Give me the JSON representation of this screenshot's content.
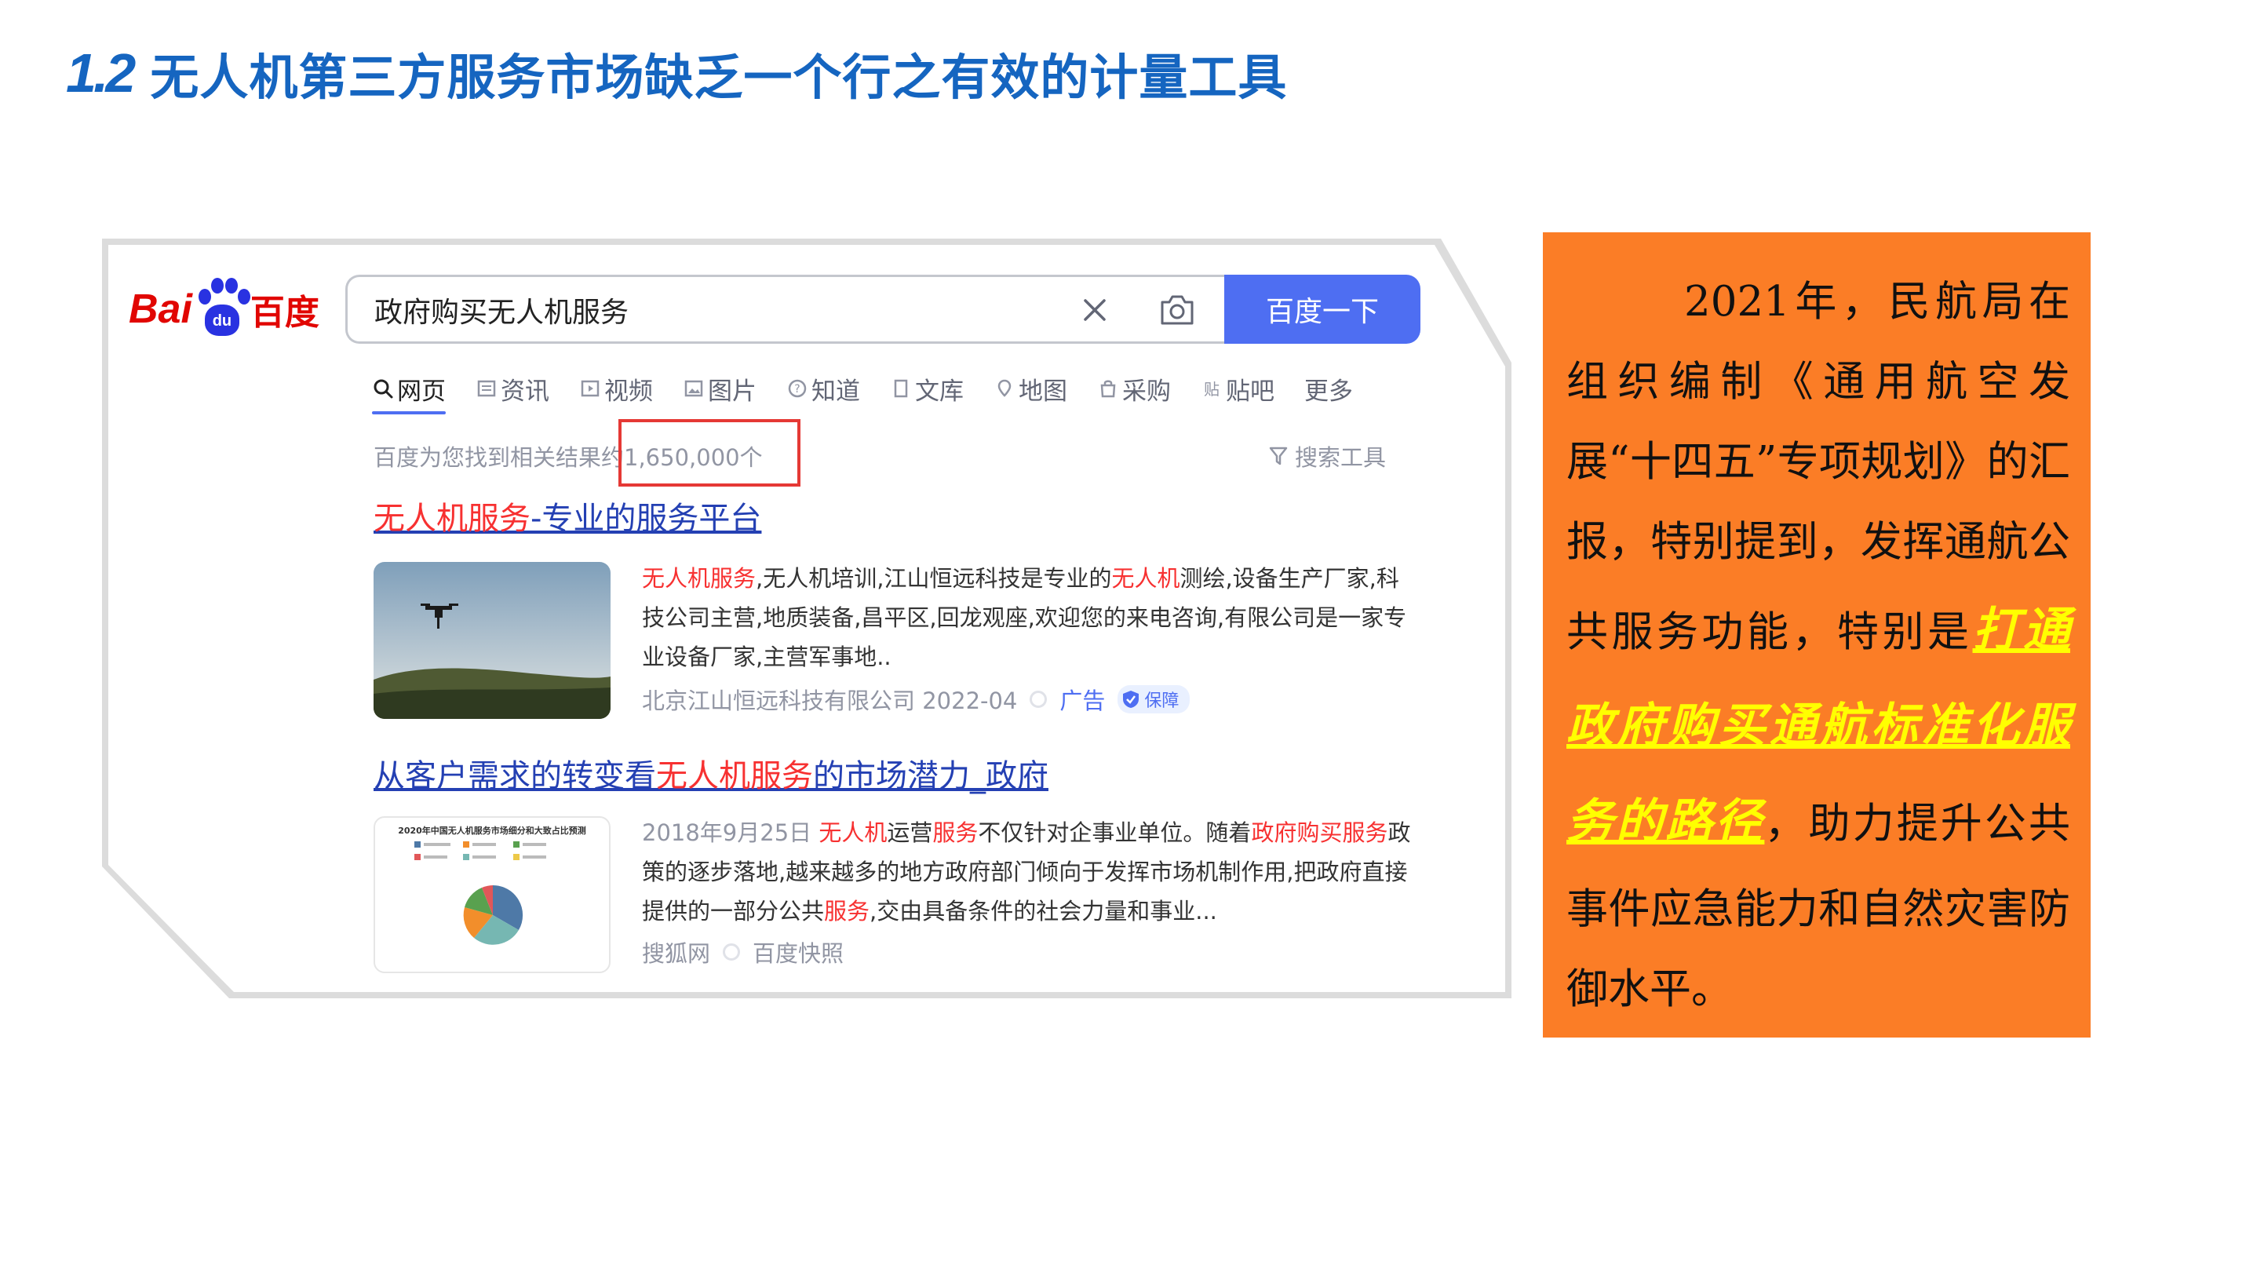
{
  "slide": {
    "number": "1.2",
    "title": "无人机第三方服务市场缺乏一个行之有效的计量工具"
  },
  "baidu": {
    "logo_bai": "Bai",
    "logo_du": "du",
    "logo_zh": "百度",
    "search": {
      "value": "政府购买无人机服务",
      "button": "百度一下"
    },
    "tabs": [
      "网页",
      "资讯",
      "视频",
      "图片",
      "知道",
      "文库",
      "地图",
      "采购",
      "贴吧",
      "更多"
    ],
    "result_count_prefix": "百度为您找到相关结果约",
    "result_count": "1,650,000个",
    "search_tools": "搜索工具",
    "results": [
      {
        "title_hl": "无人机服务",
        "title_rest": "-专业的服务平台",
        "snippet": [
          {
            "text": "无人机服务",
            "hl": true
          },
          {
            "text": ",无人机培训,江山恒远科技是专业的",
            "hl": false
          },
          {
            "text": "无人机",
            "hl": true
          },
          {
            "text": "测绘,设备生产厂家,科技公司主营,地质装备,昌平区,回龙观座,欢迎您的来电咨询,有限公司是一家专业设备厂家,主营军事地..",
            "hl": false
          }
        ],
        "source": "北京江山恒远科技有限公司 2022-04",
        "ad": "广告",
        "badge": "保障"
      },
      {
        "title_pre": "从客户需求的转变看",
        "title_hl": "无人机服务",
        "title_rest": "的市场潜力_政府",
        "thumb_title": "2020年中国无人机服务市场细分和大致占比预测",
        "snippet": [
          {
            "text": "2018年9月25日 ",
            "hl": false,
            "muted": true
          },
          {
            "text": "无人机",
            "hl": true
          },
          {
            "text": "运营",
            "hl": false
          },
          {
            "text": "服务",
            "hl": true
          },
          {
            "text": "不仅针对企事业单位。随着",
            "hl": false
          },
          {
            "text": "政府购买服务",
            "hl": true
          },
          {
            "text": "政策的逐步落地,越来越多的地方政府部门倾向于发挥市场机制作用,把政府直接提供的一部分公共",
            "hl": false
          },
          {
            "text": "服务",
            "hl": true
          },
          {
            "text": ",交由具备条件的社会力量和事业...",
            "hl": false
          }
        ],
        "source": "搜狐网",
        "snapshot": "百度快照"
      }
    ]
  },
  "panel": {
    "intro": "2021年，民航局在组织编制《通用航空发展“十四五”专项规划》的汇报，特别提到，发挥通航公共服务功能，特别是",
    "highlight": "打通政府购买通航标准化服务的路径",
    "outro": "，助力提升公共事件应急能力和自然灾害防御水平。"
  },
  "colors": {
    "title_blue": "#1565c0",
    "baidu_blue": "#4e6ef2",
    "baidu_red": "#e10602",
    "link_blue": "#2440b3",
    "highlight_red": "#f73131",
    "panel_orange": "#fb7d26",
    "panel_highlight": "#ffff00",
    "box_red": "#e53935"
  }
}
